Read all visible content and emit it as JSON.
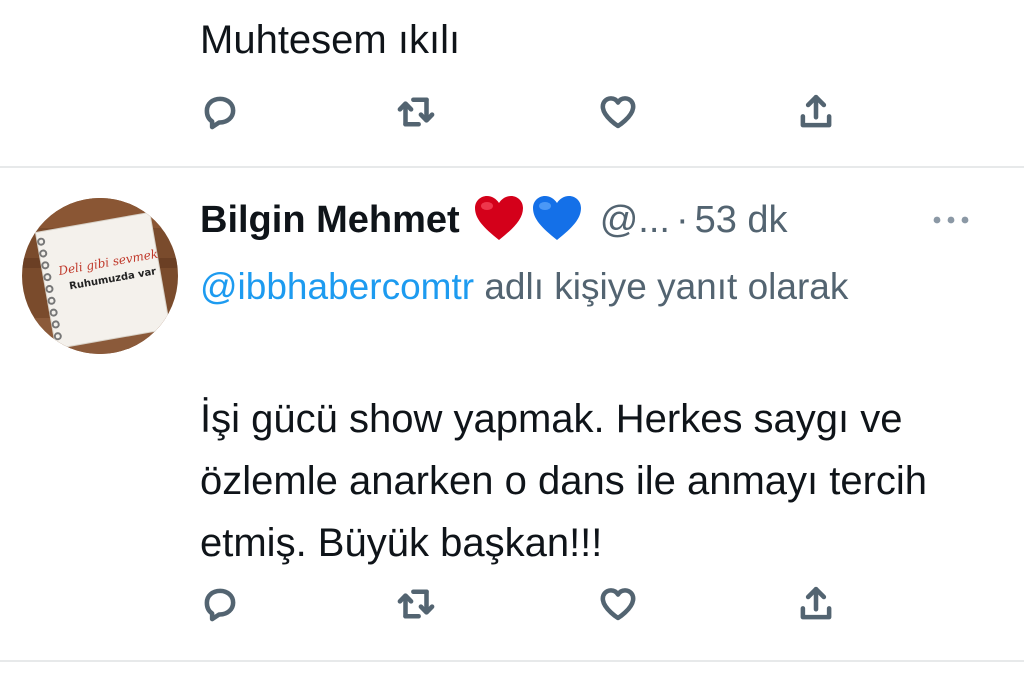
{
  "previous_tweet": {
    "text": "Muhtesem ıkılı"
  },
  "tweet": {
    "author_name": "Bilgin Mehmet",
    "emojis": [
      "red-heart",
      "blue-heart"
    ],
    "handle": "@...",
    "separator": "·",
    "time": "53 dk",
    "reply_mention": "@ibbhabercomtr",
    "reply_suffix": " adlı kişiye yanıt olarak",
    "body": "İşi gücü show yapmak. Herkes saygı ve özlemle anarken o dans ile anmayı tercih etmiş. Büyük başkan!!!",
    "avatar_text_line1": "Deli gibi sevmek",
    "avatar_text_line2": "Ruhumuzda var"
  },
  "actions": [
    {
      "name": "reply",
      "icon": "reply-icon"
    },
    {
      "name": "retweet",
      "icon": "retweet-icon"
    },
    {
      "name": "like",
      "icon": "heart-icon"
    },
    {
      "name": "share",
      "icon": "share-icon"
    }
  ],
  "colors": {
    "text_primary": "#0f1419",
    "text_secondary": "#536471",
    "link": "#1d9bf0",
    "divider": "#e7e9ea",
    "red_heart": "#d4001a",
    "blue_heart": "#1470e8"
  }
}
